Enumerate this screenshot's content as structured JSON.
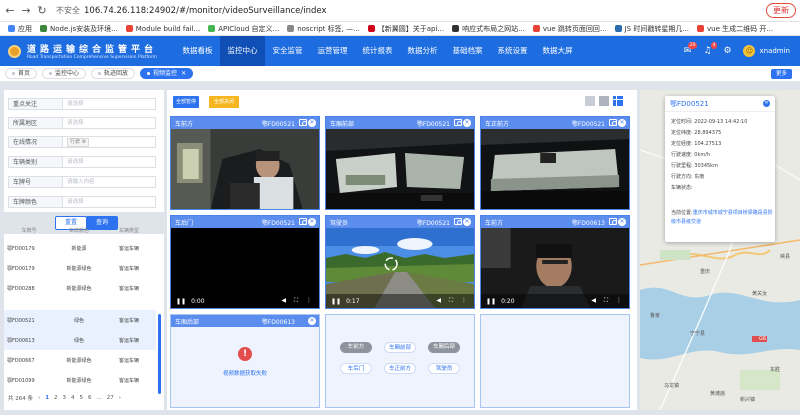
{
  "browser": {
    "secure_label": "不安全",
    "url": "106.74.26.118:24902/#/monitor/videoSurveillance/index",
    "update_label": "更新"
  },
  "bookmarks": [
    {
      "label": "应用",
      "color": "#4285f4"
    },
    {
      "label": "Node.js安装及环境...",
      "color": "#3c873a"
    },
    {
      "label": "Module build fail...",
      "color": "#e84335"
    },
    {
      "label": "APICloud 自定义...",
      "color": "#46b450"
    },
    {
      "label": "noscript 标签, —...",
      "color": "#888888"
    },
    {
      "label": "【新翼圆】关于api...",
      "color": "#d0021b"
    },
    {
      "label": "响应式布局之网站...",
      "color": "#333333"
    },
    {
      "label": "vue 跳转页面回回...",
      "color": "#e84335"
    },
    {
      "label": "JS 时间戳转星期几...",
      "color": "#2b6cb0"
    },
    {
      "label": "vue 生成二维码 开...",
      "color": "#e84335"
    }
  ],
  "header": {
    "title": "道路运输综合监管平台",
    "subtitle": "Road Transportation Comprehensive Supervision Platform",
    "nav": [
      "数据看板",
      "监控中心",
      "安全监管",
      "运营管理",
      "统计报表",
      "数据分析",
      "基础档案",
      "系统设置",
      "数据大屏"
    ],
    "active_nav": "监控中心",
    "badge_msg": "20",
    "badge_alert": "4",
    "user": "xnadmin"
  },
  "tabs": [
    {
      "label": "首页",
      "active": false
    },
    {
      "label": "监控中心",
      "active": false
    },
    {
      "label": "轨迹回放",
      "active": false
    },
    {
      "label": "视频监控",
      "active": true
    }
  ],
  "more_label": "更多",
  "filters": [
    {
      "label": "重点关注",
      "placeholder": "请选择"
    },
    {
      "label": "所属地区",
      "placeholder": "请选择"
    },
    {
      "label": "在线情况",
      "tag": "行驶 ⊗"
    },
    {
      "label": "车辆类别",
      "placeholder": "请选择"
    },
    {
      "label": "车牌号",
      "placeholder": "请输入内容"
    },
    {
      "label": "车牌颜色",
      "placeholder": "请选择"
    }
  ],
  "reset_label": "重置",
  "query_label": "查询",
  "vehicle_table": {
    "headers": [
      "车牌号",
      "车牌颜色",
      "车辆类型"
    ],
    "rows": [
      {
        "plate": "鄂FD00179",
        "color": "新能源",
        "type": "客运车辆"
      },
      {
        "plate": "鄂FD00179",
        "color": "新能源绿色",
        "type": "客运车辆"
      },
      {
        "plate": "鄂FD00288",
        "color": "新能源绿色",
        "type": "客运车辆"
      },
      {
        "plate": "鄂FD00521",
        "color": "绿色",
        "type": "客运车辆"
      },
      {
        "plate": "鄂FD00613",
        "color": "绿色",
        "type": "客运车辆"
      },
      {
        "plate": "鄂FD00667",
        "color": "新能源绿色",
        "type": "客运车辆"
      },
      {
        "plate": "鄂FD01099",
        "color": "新能源绿色",
        "type": "客运车辆"
      }
    ],
    "total": "共 264 条",
    "pages": [
      "1",
      "2",
      "3",
      "4",
      "5",
      "6",
      "...",
      "27"
    ],
    "current_page": "1"
  },
  "video": {
    "pause_all": "全部暂停",
    "close_all": "全部关闭",
    "tiles": [
      {
        "pos": "车前方",
        "plate": "鄂FD00521",
        "scene": "driver",
        "time": ""
      },
      {
        "pos": "车厢前部",
        "plate": "鄂FD00521",
        "scene": "interior",
        "time": ""
      },
      {
        "pos": "车正前方",
        "plate": "鄂FD00521",
        "scene": "dashcam",
        "time": ""
      },
      {
        "pos": "车后门",
        "plate": "鄂FD00521",
        "scene": "dark",
        "time": "0:00"
      },
      {
        "pos": "驾驶员",
        "plate": "鄂FD00521",
        "scene": "road",
        "time": "0:17"
      },
      {
        "pos": "车前方",
        "plate": "鄂FD00613",
        "scene": "face",
        "time": "0:20"
      },
      {
        "pos": "车厢后部",
        "plate": "鄂FD00613",
        "scene": "error",
        "error_text": "视频数据获取失败"
      },
      {
        "scene": "chips",
        "chips": [
          {
            "label": "车前方",
            "on": true
          },
          {
            "label": "车厢前部",
            "on": false
          },
          {
            "label": "车厢后部",
            "on": true
          },
          {
            "label": "车后门",
            "on": false
          },
          {
            "label": "车正前方",
            "on": false
          },
          {
            "label": "驾驶员",
            "on": false
          }
        ]
      },
      {
        "scene": "blank"
      }
    ]
  },
  "map": {
    "popup": {
      "plate": "鄂FD00521",
      "rows": [
        {
          "label": "定位时间:",
          "value": "2022-09-13 14:42:10"
        },
        {
          "label": "定位纬度:",
          "value": "28.894375"
        },
        {
          "label": "定位经度:",
          "value": "104.27513"
        },
        {
          "label": "行驶速度:",
          "value": "0km/h"
        },
        {
          "label": "行驶里程:",
          "value": "30345km"
        },
        {
          "label": "行驶方向:",
          "value": "东南"
        },
        {
          "label": "车辆状态:",
          "value": ""
        }
      ],
      "address_label": "当前位置:",
      "address": "重庆市城市城宁县项目桥梁路段县阶级市县级交道"
    },
    "labels": [
      "峡县",
      "黄关汝",
      "重庆",
      "G6",
      "东胜",
      "宁宁县",
      "马龙镇",
      "鲁家",
      "新兴镇",
      "黄滩庙"
    ]
  }
}
